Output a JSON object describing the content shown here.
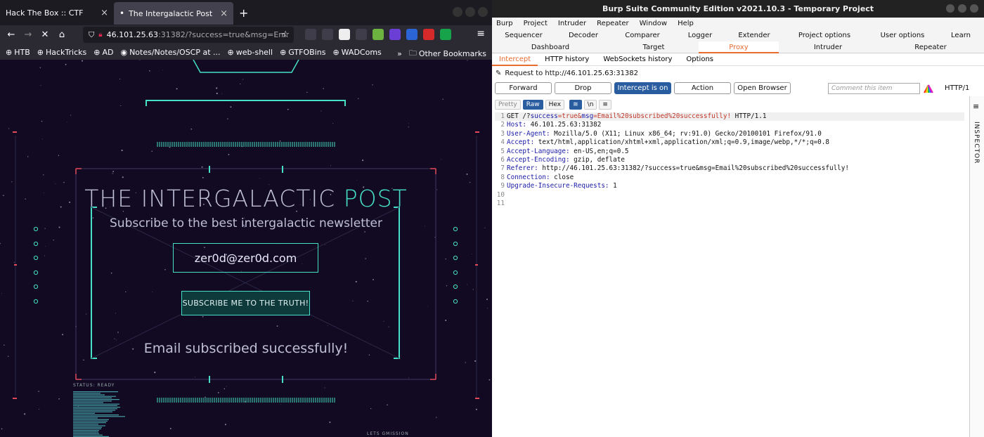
{
  "firefox": {
    "tabs": [
      {
        "label": "Hack The Box :: CTF",
        "close": "×"
      },
      {
        "label": "The Intergalactic Post",
        "close": "×",
        "active": true
      }
    ],
    "new_tab": "+",
    "url_main": "46.101.25.63",
    "url_rest": ":31382/?success=true&msg=Em",
    "bookmarks": [
      "HTB",
      "HackTricks",
      "AD",
      "Notes/Notes/OSCP at ...",
      "web-shell",
      "GTFOBins",
      "WADComs"
    ],
    "more_bookmarks": "»",
    "other_bookmarks": "Other Bookmarks",
    "extensions": [
      {
        "icon": "pocket-icon",
        "color": "#3f3d4a"
      },
      {
        "icon": "download-icon",
        "color": "#3f3d4a"
      },
      {
        "icon": "z-icon",
        "color": "#eeeeee"
      },
      {
        "icon": "globe-icon",
        "color": "#3f3d4a"
      },
      {
        "icon": "burp-icon",
        "color": "#6cb33f"
      },
      {
        "icon": "cube-icon",
        "color": "#6b3fd6"
      },
      {
        "icon": "translate-icon",
        "color": "#2a64d6"
      },
      {
        "icon": "hand-icon",
        "color": "#d62a2a"
      },
      {
        "icon": "grammarly-icon",
        "color": "#16a34a"
      }
    ]
  },
  "site": {
    "title_main": "THE INTERGALACTIC ",
    "title_accent": "POST",
    "subtitle": "Subscribe to the best intergalactic newsletter",
    "email_value": "zer0d@zer0d.com",
    "button_label": "SUBSCRIBE ME TO THE TRUTH!",
    "message": "Email subscribed successfully!",
    "status": "STATUS: READY",
    "footer": "LETS GMISSION",
    "accent_color": "#46e0c8"
  },
  "burp": {
    "title": "Burp Suite Community Edition v2021.10.3 - Temporary Project",
    "menu": [
      "Burp",
      "Project",
      "Intruder",
      "Repeater",
      "Window",
      "Help"
    ],
    "tabs_row1": [
      "Sequencer",
      "Decoder",
      "Comparer",
      "Logger",
      "Extender",
      "Project options",
      "User options",
      "Learn"
    ],
    "tabs_row2": [
      "Dashboard",
      "Target",
      "Proxy",
      "Intruder",
      "Repeater"
    ],
    "subtabs": [
      "Intercept",
      "HTTP history",
      "WebSockets history",
      "Options"
    ],
    "request_to": "Request to http://46.101.25.63:31382",
    "actions": {
      "forward": "Forward",
      "drop": "Drop",
      "intercept": "Intercept is on",
      "action": "Action",
      "open_browser": "Open Browser"
    },
    "comment_placeholder": "Comment this item",
    "http_version": "HTTP/1",
    "view": {
      "pretty": "Pretty",
      "raw": "Raw",
      "hex": "Hex",
      "newline": "\\n"
    },
    "inspector": "INSPECTOR",
    "request_lines": [
      {
        "n": "1",
        "method": "GET /?",
        "p1": "success",
        "v1": "=true&",
        "p2": "msg",
        "v2": "=Email%20subscribed%20successfully!",
        "tail": " HTTP/1.1"
      },
      {
        "n": "2",
        "key": "Host:",
        "val": " 46.101.25.63:31382"
      },
      {
        "n": "3",
        "key": "User-Agent:",
        "val": " Mozilla/5.0 (X11; Linux x86_64; rv:91.0) Gecko/20100101 Firefox/91.0"
      },
      {
        "n": "4",
        "key": "Accept:",
        "val": " text/html,application/xhtml+xml,application/xml;q=0.9,image/webp,*/*;q=0.8"
      },
      {
        "n": "5",
        "key": "Accept-Language:",
        "val": " en-US,en;q=0.5"
      },
      {
        "n": "6",
        "key": "Accept-Encoding:",
        "val": " gzip, deflate"
      },
      {
        "n": "7",
        "key": "Referer:",
        "val": " http://46.101.25.63:31382/?success=true&msg=Email%20subscribed%20successfully!"
      },
      {
        "n": "8",
        "key": "Connection:",
        "val": " close"
      },
      {
        "n": "9",
        "key": "Upgrade-Insecure-Requests:",
        "val": " 1"
      },
      {
        "n": "10"
      },
      {
        "n": "11"
      }
    ]
  }
}
